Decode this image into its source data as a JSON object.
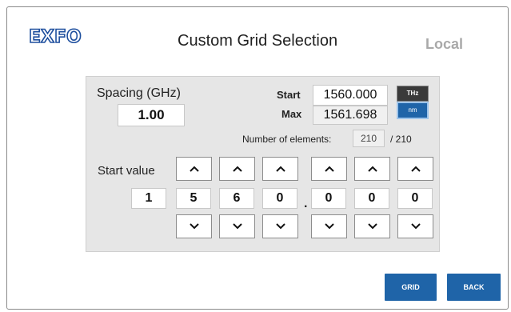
{
  "header": {
    "logo": "EXFO",
    "title": "Custom Grid Selection",
    "mode": "Local"
  },
  "spacing": {
    "label": "Spacing (GHz)",
    "value": "1.00"
  },
  "start": {
    "label": "Start",
    "value": "1560.000"
  },
  "max": {
    "label": "Max",
    "value": "1561.698"
  },
  "units": {
    "thz": "THz",
    "nm": "nm",
    "selected": "nm"
  },
  "elements": {
    "label": "Number of elements:",
    "value": "210",
    "total": "/ 210"
  },
  "start_value": {
    "label": "Start value",
    "digits": [
      "1",
      "5",
      "6",
      "0",
      "0",
      "0",
      "0"
    ],
    "separator": "."
  },
  "buttons": {
    "grid": "GRID",
    "back": "BACK"
  },
  "colors": {
    "accent": "#1f64a8",
    "logo": "#1e4f9e",
    "panel": "#e6e6e6",
    "muted": "#a9a9a9"
  },
  "icons": {
    "up": "chevron-up-icon",
    "down": "chevron-down-icon"
  }
}
